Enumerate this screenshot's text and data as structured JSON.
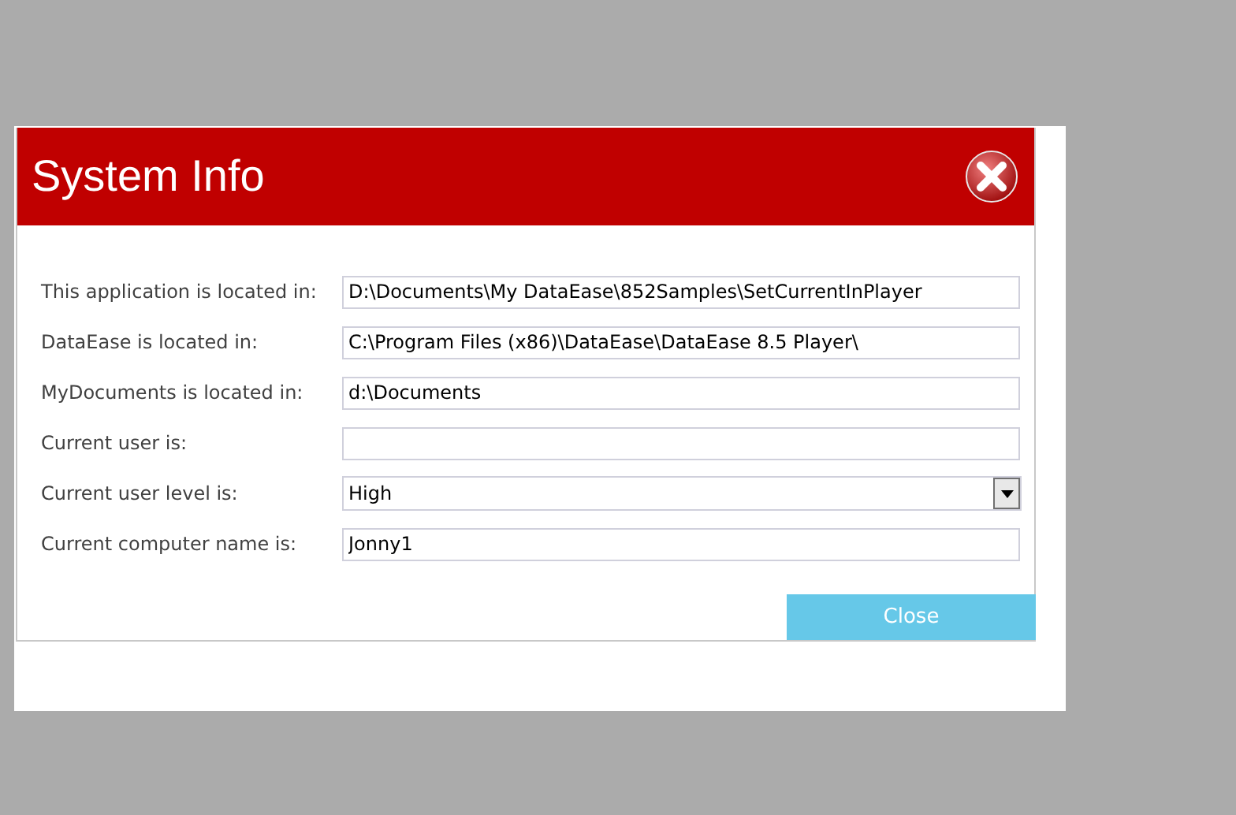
{
  "window": {
    "title": "System Info"
  },
  "fields": [
    {
      "label": "This application is located in:",
      "kind": "text",
      "value": "D:\\Documents\\My DataEase\\852Samples\\SetCurrentInPlayer"
    },
    {
      "label": "DataEase is located in:",
      "kind": "text",
      "value": "C:\\Program Files (x86)\\DataEase\\DataEase 8.5 Player\\"
    },
    {
      "label": "MyDocuments is located in:",
      "kind": "text",
      "value": "d:\\Documents"
    },
    {
      "label": "Current user is:",
      "kind": "text"
    },
    {
      "label": "Current user level is:",
      "kind": "dropdown",
      "value": "High"
    },
    {
      "label": "Current computer name is:",
      "kind": "text",
      "value": "Jonny1"
    }
  ],
  "buttons": [
    "Close"
  ]
}
